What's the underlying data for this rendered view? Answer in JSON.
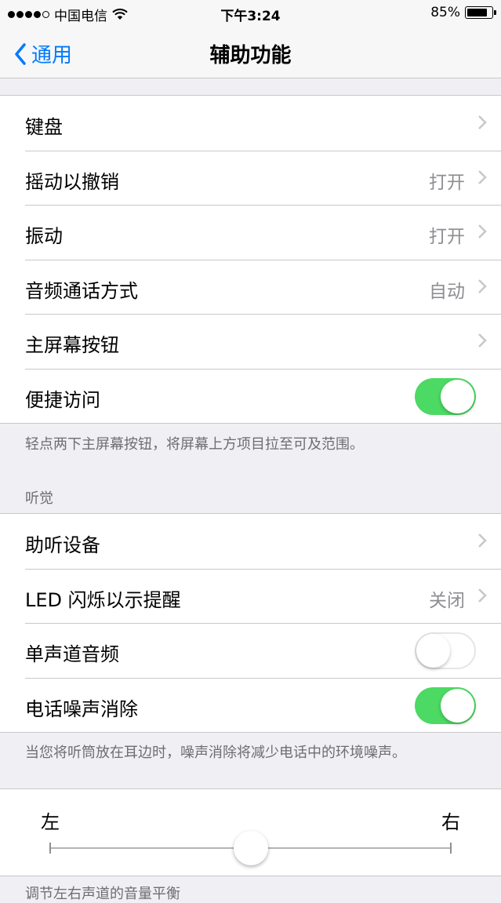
{
  "status_bar": {
    "carrier": "中国电信",
    "time": "下午3:24",
    "battery_text": "85%",
    "battery_level": 0.85
  },
  "nav": {
    "back_label": "通用",
    "title": "辅助功能"
  },
  "group1": {
    "rows": [
      {
        "label": "键盘",
        "value": ""
      },
      {
        "label": "摇动以撤销",
        "value": "打开"
      },
      {
        "label": "振动",
        "value": "打开"
      },
      {
        "label": "音频通话方式",
        "value": "自动"
      },
      {
        "label": "主屏幕按钮",
        "value": ""
      },
      {
        "label": "便捷访问",
        "toggle": true
      }
    ],
    "footer": "轻点两下主屏幕按钮，将屏幕上方项目拉至可及范围。"
  },
  "hearing": {
    "header": "听觉",
    "rows": [
      {
        "label": "助听设备",
        "value": ""
      },
      {
        "label": "LED 闪烁以示提醒",
        "value": "关闭"
      },
      {
        "label": "单声道音频",
        "toggle": false
      },
      {
        "label": "电话噪声消除",
        "toggle": true
      }
    ],
    "footer": "当您将听筒放在耳边时，噪声消除将减少电话中的环境噪声。"
  },
  "balance": {
    "left_label": "左",
    "right_label": "右",
    "position": 0.5
  },
  "truncated_footer": "调节左右声道的音量平衡"
}
